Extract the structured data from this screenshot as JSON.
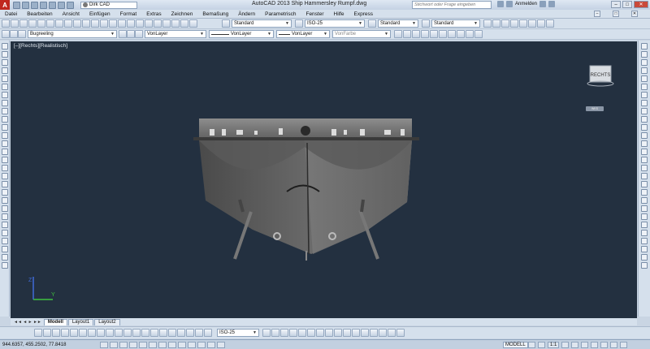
{
  "title_bar": {
    "app_logo": "A",
    "workspace": "Dirk CAD",
    "title": "AutoCAD 2013    Ship Hammersley Rumpf.dwg",
    "search_placeholder": "Stichwort oder Frage eingeben",
    "login": "Anmelden",
    "minimize": "–",
    "maximize": "□",
    "close": "✕"
  },
  "menu": [
    "Datei",
    "Bearbeiten",
    "Ansicht",
    "Einfügen",
    "Format",
    "Extras",
    "Zeichnen",
    "Bemaßung",
    "Ändern",
    "Parametrisch",
    "Fenster",
    "Hilfe",
    "Express"
  ],
  "toolbar1": {
    "textstyle": "Standard",
    "dimstyle": "ISO-25",
    "tablestyle": "Standard",
    "mleaderstyle": "Standard"
  },
  "toolbar2": {
    "layer": "Bugreeling",
    "color": "VonLayer",
    "linetype": "VonLayer",
    "lineweight": "VonLayer",
    "plotstyle": "VonFarbe"
  },
  "viewport": {
    "label": "[–][Rechts][Realistisch]",
    "viewcube_face": "RECHTS",
    "wcs_label": "WKS"
  },
  "tabs": {
    "nav": "◄◄ ◄ ► ►►",
    "items": [
      "Modell",
      "Layout1",
      "Layout2"
    ],
    "active": "Modell"
  },
  "bottom_toolbar": {
    "dimstyle": "ISO-25"
  },
  "status": {
    "coordinates": "944.6357, 455.2502, 77.8418",
    "model": "MODELL",
    "scale": "1:1"
  },
  "colors": {
    "viewport_bg": "#233040",
    "ui_bg": "#d5e0ec",
    "hull": "#6a6a6a"
  }
}
